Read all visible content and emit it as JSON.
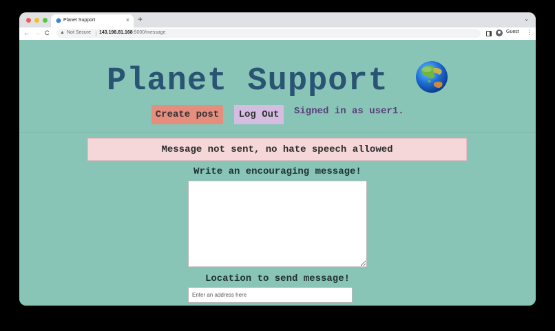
{
  "browser": {
    "tab_title": "Planet Support",
    "new_tab": "+",
    "tab_close": "×",
    "tab_search": "⌄",
    "security_label": "Not Secure",
    "url_host": "143.198.81.168",
    "url_path": ":5000/message",
    "profile_name": "Guest",
    "menu": "⋮",
    "back": "←",
    "forward": "→",
    "reload": "C"
  },
  "header": {
    "title": "Planet Support",
    "logo_icon": "globe-asia-australia-icon"
  },
  "nav": {
    "create_post": "Create post",
    "log_out": "Log Out",
    "signed_in": "Signed in as user1."
  },
  "flash": {
    "message": "Message not sent, no hate speech allowed"
  },
  "form": {
    "message_label": "Write an encouraging message!",
    "message_value": "",
    "location_label": "Location to send message!",
    "location_placeholder": "Enter an address here",
    "location_value": ""
  },
  "colors": {
    "page_background": "#88c5b6",
    "title": "#2a5474",
    "create_button": "#e58e7e",
    "logout_button": "#d4bde1",
    "signed_in_text": "#5b3e79",
    "flash_background": "#f5d6d9"
  }
}
